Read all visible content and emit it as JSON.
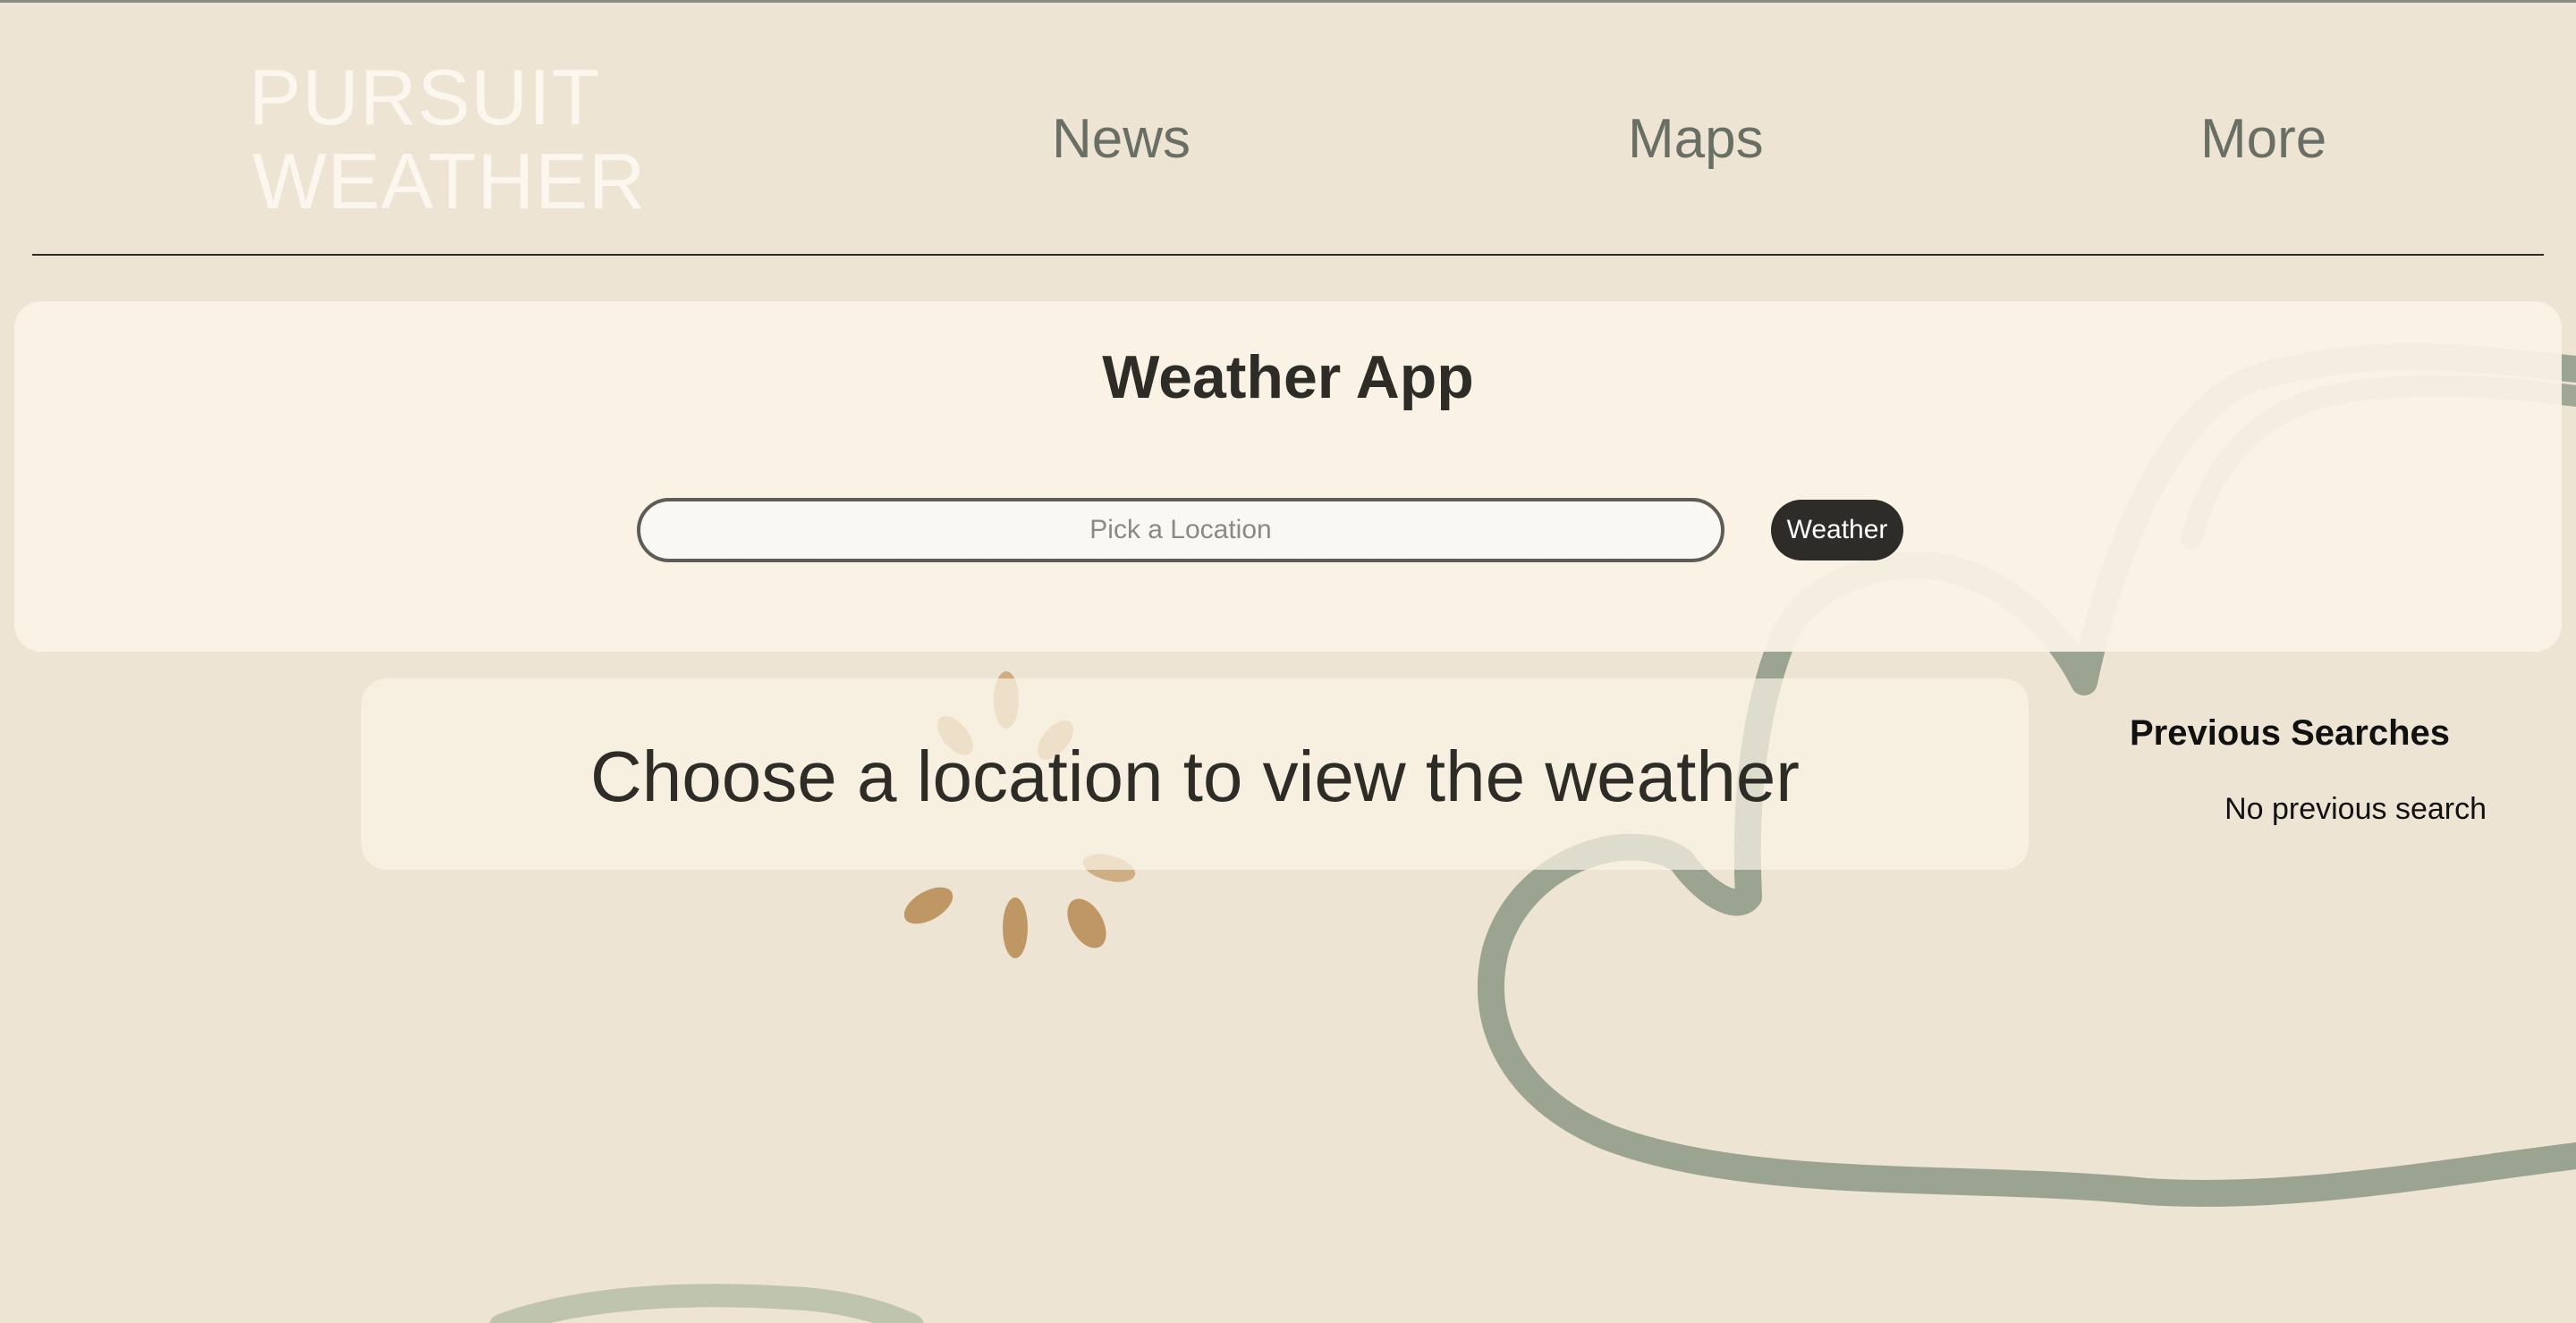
{
  "header": {
    "logo_line1": "PURSUIT",
    "logo_line2": "WEATHER",
    "nav": [
      {
        "label": "News"
      },
      {
        "label": "Maps"
      },
      {
        "label": "More"
      }
    ]
  },
  "search_card": {
    "title": "Weather App",
    "input_placeholder": "Pick a Location",
    "input_value": "",
    "button_label": "Weather"
  },
  "message": {
    "text": "Choose a location to view the weather"
  },
  "previous_searches": {
    "heading": "Previous Searches",
    "empty_text": "No previous search"
  },
  "colors": {
    "background": "#ede4d3",
    "card": "#fbf3e6",
    "button": "#2e2c28",
    "nav_text": "#6a6f66",
    "logo": "#fbf6ee",
    "squiggle": "#97a08d",
    "flower": "#b68a52"
  }
}
